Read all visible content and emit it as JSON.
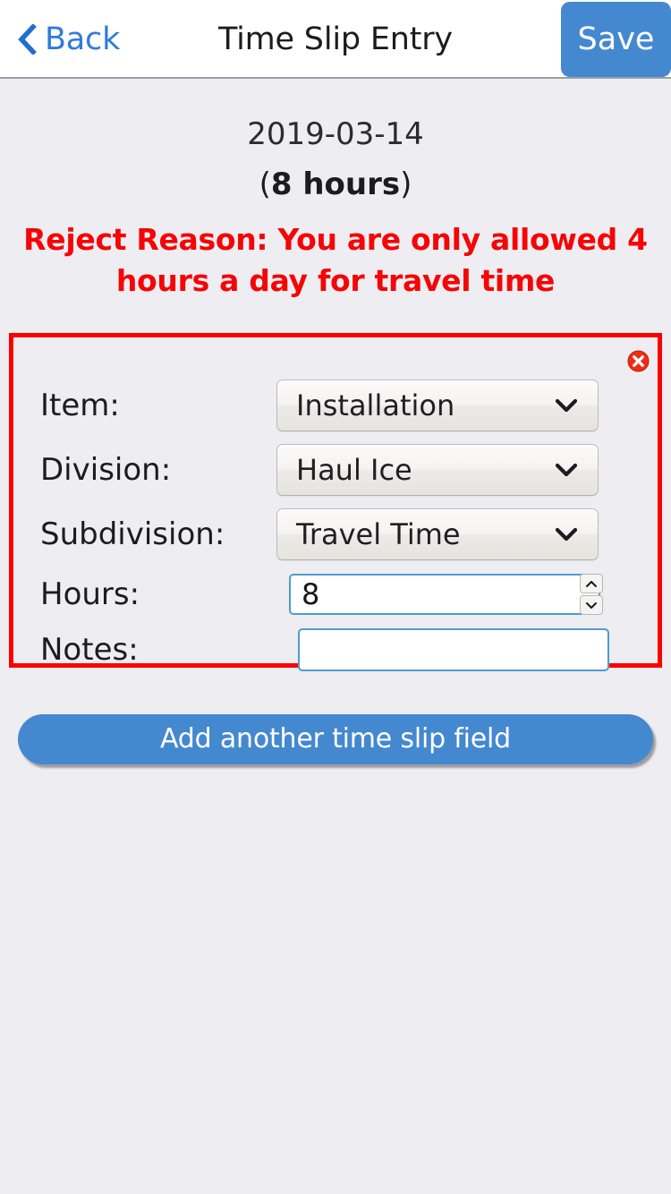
{
  "header": {
    "back_label": "Back",
    "back_icon": "chevron-left-icon",
    "title": "Time Slip Entry",
    "save_label": "Save",
    "accent_color": "#4488d0",
    "back_color": "#2f7bd8"
  },
  "summary": {
    "date": "2019-03-14",
    "hours_prefix": "(",
    "hours_value": "8 hours",
    "hours_suffix": ")",
    "reject_reason": "Reject Reason: You are only allowed 4 hours a day for travel time",
    "reject_color": "#f50505"
  },
  "entry": {
    "remove_icon": "remove-circle-icon",
    "border_color": "#fc0000",
    "fields": [
      {
        "label": "Item:",
        "type": "select",
        "value": "Installation",
        "caret_icon": "chevron-down-icon",
        "name": "item"
      },
      {
        "label": "Division:",
        "type": "select",
        "value": "Haul Ice",
        "caret_icon": "chevron-down-icon",
        "name": "division"
      },
      {
        "label": "Subdivision:",
        "type": "select",
        "value": "Travel Time",
        "caret_icon": "chevron-down-icon",
        "name": "subdivision"
      },
      {
        "label": "Hours:",
        "type": "number",
        "value": "8",
        "placeholder": "",
        "name": "hours"
      },
      {
        "label": "Notes:",
        "type": "text",
        "value": "",
        "placeholder": "",
        "name": "notes"
      }
    ]
  },
  "footer": {
    "add_label": "Add another time slip field"
  }
}
